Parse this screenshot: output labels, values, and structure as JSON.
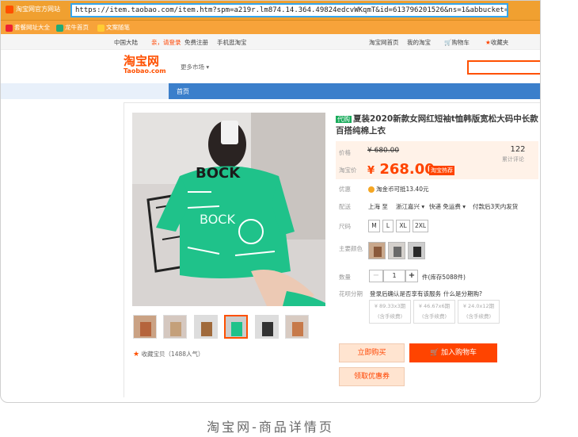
{
  "browser": {
    "tab_title": "淘宝网官方网站",
    "url": "https://item.taobao.com/item.htm?spm=a219r.lm874.14.364.49824edcvWKqmT&id=613796201526&ns=1&abbucket=16"
  },
  "bookmarks": [
    "套餐网址大全",
    "龙牛首页",
    "文案随笔"
  ],
  "topnav": {
    "region": "中国大陆",
    "hello": "亲，请登录",
    "register": "免费注册",
    "mobile": "手机逛淘宝",
    "home": "淘宝网首页",
    "my": "我的淘宝",
    "cart": "购物车",
    "fav": "收藏夹"
  },
  "header": {
    "logo_cn": "淘宝网",
    "logo_en": "Taobao.com",
    "market": "更多市场"
  },
  "catbar": {
    "home": "首页"
  },
  "product": {
    "tag": "代购",
    "title": "夏装2020新款女网红短袖t恤韩版宽松大码中长款百搭纯棉上衣",
    "price_label": "价格",
    "orig_price": "¥ 680.00",
    "now_label": "淘宝价",
    "currency": "¥",
    "now_price": "268.00",
    "promo": "淘宝热荐",
    "review_count": "122",
    "review_label": "累计评论",
    "promo_label": "优惠",
    "coin_text": "淘金币可抵13.40元",
    "ship_label": "配送",
    "ship_from": "上海 至",
    "ship_to": "浙江嘉兴",
    "express": "快递 免运费",
    "ship_time": "付款后3天内发货",
    "size_label": "尺码",
    "sizes": [
      "M",
      "L",
      "XL",
      "2XL"
    ],
    "color_label": "主要颜色",
    "qty_label": "数量",
    "qty": "1",
    "stock": "件(库存5088件)",
    "installment_label": "花呗分期",
    "installment_note": "登录后确认是否享有该服务",
    "installment_link": "什么是分期购?",
    "installments": [
      {
        "amount": "¥ 89.33x3期",
        "fee": "(含手续费)"
      },
      {
        "amount": "¥ 46.67x6期",
        "fee": "(含手续费)"
      },
      {
        "amount": "¥ 24.0x12期",
        "fee": "(含手续费)"
      }
    ],
    "buy_now": "立即购买",
    "add_cart": "加入购物车",
    "coupon": "领取优惠券",
    "fav": "收藏宝贝",
    "popularity": "（1488人气）"
  },
  "caption": "淘宝网-商品详情页",
  "colors": {
    "accent": "#ff5000",
    "price": "#f40",
    "nav_blue": "#3b7fcb",
    "tag_green": "#1aac5c"
  }
}
